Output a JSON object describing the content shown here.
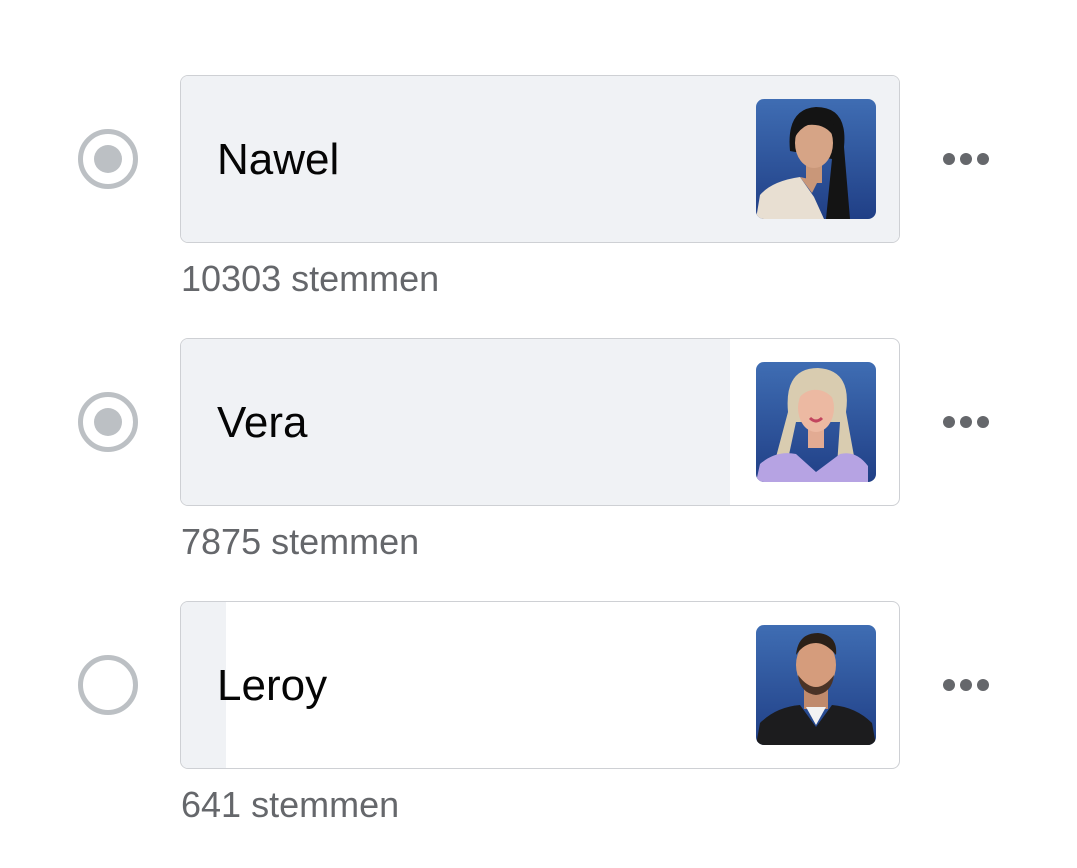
{
  "poll": {
    "options": [
      {
        "name": "Nawel",
        "votes_label": "10303 stemmen",
        "votes": 10303,
        "selected_indicator": true,
        "vote_share_fill": 1.0,
        "avatar": "portrait-photo-woman-dark-hair"
      },
      {
        "name": "Vera",
        "votes_label": "7875 stemmen",
        "votes": 7875,
        "selected_indicator": true,
        "vote_share_fill": 0.764,
        "avatar": "portrait-photo-woman-blonde-hair"
      },
      {
        "name": "Leroy",
        "votes_label": "641 stemmen",
        "votes": 641,
        "selected_indicator": false,
        "vote_share_fill": 0.062,
        "avatar": "portrait-photo-man-leather-jacket"
      }
    ]
  },
  "icons": {
    "more": "more-horizontal-icon",
    "radio": "radio-button-icon"
  },
  "colors": {
    "fill": "#f0f2f5",
    "border": "#ced0d4",
    "radio": "#bcc0c4",
    "secondary_text": "#65676b",
    "primary_text": "#050505"
  }
}
